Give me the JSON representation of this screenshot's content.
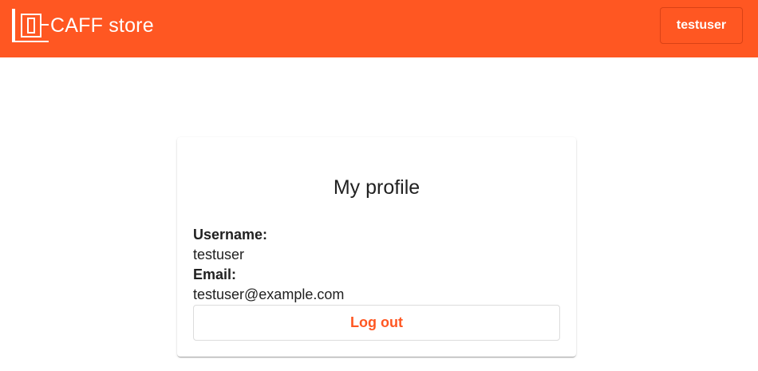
{
  "header": {
    "brand_title": "CAFF store",
    "logo_icon": "caff-logo-icon",
    "user_button_label": "testuser",
    "background_color": "#ff5722"
  },
  "profile_card": {
    "title": "My profile",
    "username_label": "Username:",
    "username_value": "testuser",
    "email_label": "Email:",
    "email_value": "testuser@example.com",
    "logout_label": "Log out",
    "accent_color": "#ff5722"
  }
}
